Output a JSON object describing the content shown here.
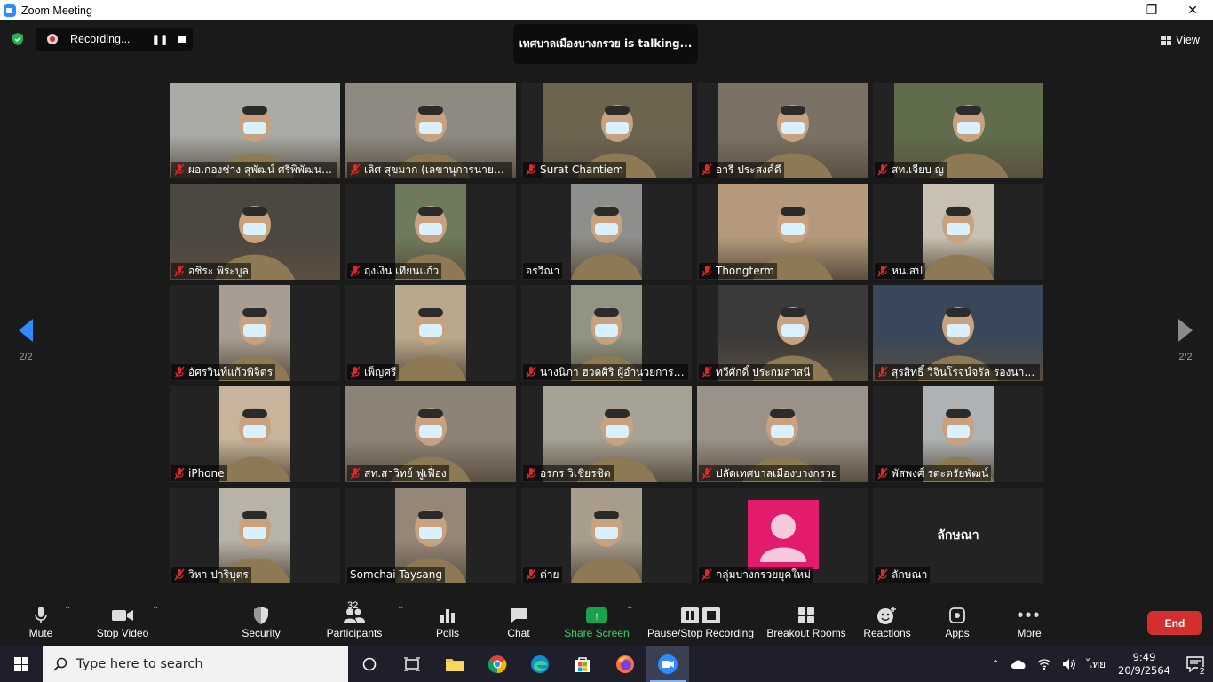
{
  "window": {
    "title": "Zoom Meeting",
    "controls": [
      "minimize",
      "maximize",
      "close"
    ]
  },
  "recording": {
    "label": "Recording..."
  },
  "talking_banner": "เทศบาลเมืองบางกรวย is  talking...",
  "view_label": "View",
  "page_indicator": {
    "left": "2/2",
    "right": "2/2"
  },
  "tiles": [
    {
      "name": "ผอ.กองช่าง สุพัฒน์ ศรีพิพัฒนกุล",
      "muted": true,
      "video": true,
      "bg": "#a9aba7"
    },
    {
      "name": "เลิศ สุขมาก (เลขานุการนายกเทศ...",
      "muted": true,
      "video": true,
      "bg": "#8e8a82"
    },
    {
      "name": "Surat Chantiem",
      "muted": true,
      "video": true,
      "bg": "#6d6450",
      "narrow": true
    },
    {
      "name": "อารี ประสงค์ดี",
      "muted": true,
      "video": true,
      "bg": "#7b7265",
      "narrow": true
    },
    {
      "name": "สท.เจียบ ญ",
      "muted": true,
      "video": true,
      "bg": "#5f6d4c",
      "narrow": true
    },
    {
      "name": "อชิระ พิระบูล",
      "muted": true,
      "video": true,
      "bg": "#4b4741"
    },
    {
      "name": "ฤงเงิน เทียนแก้ว",
      "muted": true,
      "video": true,
      "bg": "#6e7a5c",
      "narrow2": true
    },
    {
      "name": "อรวีณา",
      "muted": false,
      "video": true,
      "bg": "#8d8f8c",
      "narrow2": true
    },
    {
      "name": "Thongterm",
      "muted": true,
      "video": true,
      "bg": "#b49a7a",
      "narrow": true
    },
    {
      "name": "หน.สป",
      "muted": true,
      "video": true,
      "bg": "#c8c0b0",
      "narrow2": true
    },
    {
      "name": "อัศรวินท์แก้วพิจิตร",
      "muted": true,
      "video": true,
      "bg": "#a89b91",
      "narrow2": true
    },
    {
      "name": "เพ็ญศรี",
      "muted": true,
      "video": true,
      "bg": "#b9a98c",
      "narrow2": true
    },
    {
      "name": "นางนิภา ฮวดศิริ  ผู้อำนวยการก...",
      "muted": true,
      "video": true,
      "bg": "#8f9582",
      "narrow2": true
    },
    {
      "name": "ทวีศักดิ์ ประกมสาสนี",
      "muted": true,
      "video": true,
      "bg": "#3a3a38",
      "narrow": true
    },
    {
      "name": "สุรสิทธิ์ วิจินโรจน์จรัล รองนายก...",
      "muted": true,
      "video": true,
      "bg": "#38475a"
    },
    {
      "name": "iPhone",
      "muted": true,
      "video": true,
      "bg": "#c7b49a",
      "narrow2": true
    },
    {
      "name": "สท.สาวิทย์  ฟูเฟื่อง",
      "muted": true,
      "video": true,
      "bg": "#8c8376"
    },
    {
      "name": "อรกร วิเชียรชิต",
      "muted": true,
      "video": true,
      "bg": "#a5a195",
      "narrow": true
    },
    {
      "name": "ปลัดเทศบาลเมืองบางกรวย",
      "muted": true,
      "video": true,
      "bg": "#9a9189",
      "wide": true
    },
    {
      "name": "พัสพงศ์  รตะตรัยพัฒน์",
      "muted": true,
      "video": true,
      "bg": "#aeb2b5",
      "narrow2": true
    },
    {
      "name": "วิหา ปาริบุตร",
      "muted": true,
      "video": true,
      "bg": "#b7b3a9",
      "narrow2": true
    },
    {
      "name": "Somchai Taysang",
      "muted": false,
      "video": true,
      "bg": "#958777",
      "narrow2": true
    },
    {
      "name": "ต่าย",
      "muted": true,
      "video": true,
      "bg": "#a89d8c",
      "narrow2": true
    },
    {
      "name": "กลุ่มบางกรวยยุคใหม่",
      "muted": true,
      "video": false,
      "avatar": true
    },
    {
      "name": "ลักษณา",
      "muted": true,
      "video": false,
      "display": "ลักษณา"
    }
  ],
  "toolbar": {
    "mute": "Mute",
    "stop_video": "Stop Video",
    "security": "Security",
    "participants": "Participants",
    "participants_count": "32",
    "polls": "Polls",
    "chat": "Chat",
    "share_screen": "Share Screen",
    "pause_stop_recording": "Pause/Stop Recording",
    "breakout_rooms": "Breakout Rooms",
    "reactions": "Reactions",
    "apps": "Apps",
    "more": "More",
    "end": "End"
  },
  "taskbar": {
    "search_placeholder": "Type here to search",
    "language": "ไทย",
    "time": "9:49",
    "date": "20/9/2564",
    "notification_count": "2",
    "apps": [
      "task-view",
      "file-explorer",
      "chrome",
      "edge",
      "store",
      "firefox",
      "zoom"
    ]
  },
  "colors": {
    "accent": "#2d8cff",
    "end": "#d32f2f",
    "share": "#16a34a",
    "muted_icon": "#e02828"
  }
}
